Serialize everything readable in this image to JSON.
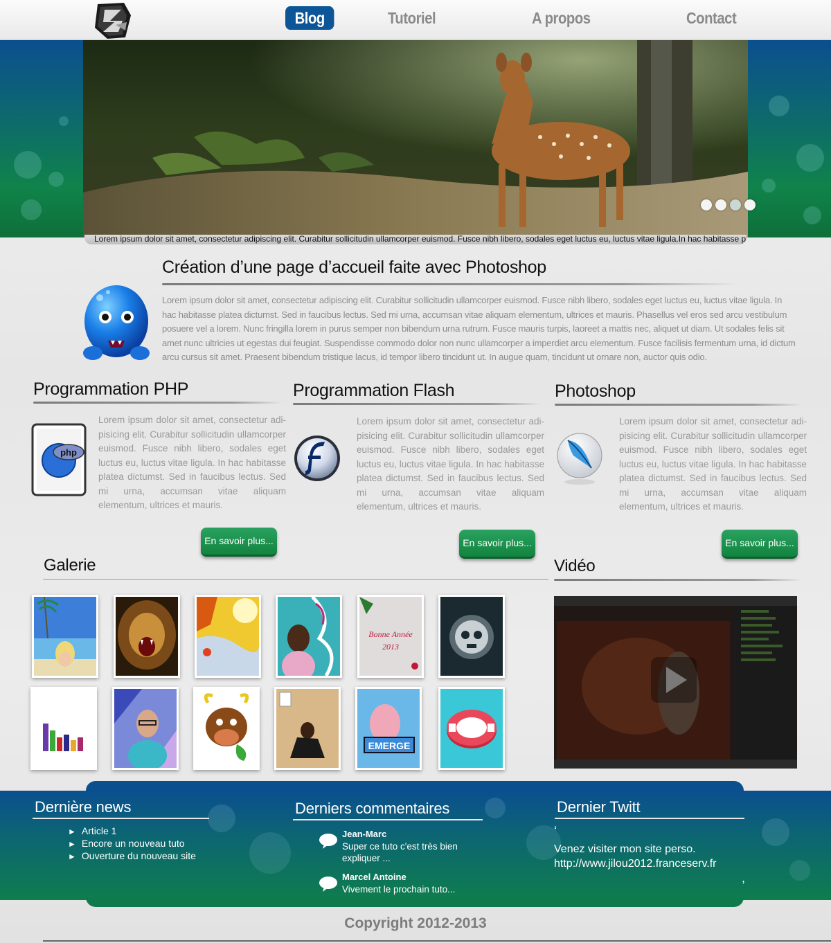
{
  "nav": {
    "items": [
      {
        "label": "Blog",
        "active": true
      },
      {
        "label": "Tutoriel"
      },
      {
        "label": "A propos"
      },
      {
        "label": "Contact"
      }
    ]
  },
  "banner": {
    "caption": "Lorem ipsum dolor sit amet, consectetur adipiscing elit. Curabitur sollicitudin ullamcorper euismod. Fusce nibh libero, sodales eget luctus eu, luctus vitae ligula.In hac habitasse platea dictumst.",
    "slide_count": 4,
    "active_slide": 1
  },
  "intro": {
    "title": "Création d’une page d’accueil faite avec Photoshop",
    "text": "Lorem ipsum dolor sit amet, consectetur adipiscing elit. Curabitur sollicitudin ullamcorper euismod. Fusce nibh libero, sodales eget luctus eu, luctus vitae ligula. In hac habitasse platea dictumst. Sed in faucibus lectus. Sed mi urna, accumsan vitae aliquam elementum, ultrices et mauris. Phasellus vel eros sed arcu vestibulum posuere vel a lorem. Nunc fringilla lorem in purus semper non bibendum urna rutrum. Fusce mauris turpis, laoreet a mattis nec, aliquet ut diam. Ut sodales felis sit amet nunc ultricies ut egestas dui feugiat. Suspendisse commodo dolor non nunc ullamcorper a imperdiet arcu elementum. Fusce facilisis fermentum urna, id dictum arcu cursus sit amet. Praesent bibendum tristique lacus, id tempor libero tincidunt ut. In augue quam, tincidunt ut ornare non, auctor quis odio."
  },
  "columns": [
    {
      "title": "Programmation PHP",
      "icon": "php-icon",
      "text": "Lorem ipsum dolor sit amet, consectetur adi-pisicing elit. Curabitur sollicitudin ullamcorper euismod. Fusce nibh libero, sodales eget luctus eu, luctus vitae ligula. In hac habitasse platea dictumst. Sed in faucibus lectus. Sed mi urna, accumsan vitae aliquam elementum, ultrices et mauris.",
      "button": "En savoir plus..."
    },
    {
      "title": "Programmation Flash",
      "icon": "flash-icon",
      "text": "Lorem ipsum dolor sit amet, consectetur adi-pisicing elit. Curabitur sollicitudin ullamcorper euismod. Fusce nibh libero, sodales eget luctus eu, luctus vitae ligula. In hac habitasse platea dictumst. Sed in faucibus lectus. Sed mi urna, accumsan vitae aliquam elementum, ultrices et mauris.",
      "button": "En savoir plus..."
    },
    {
      "title": "Photoshop",
      "icon": "feather-icon",
      "text": "Lorem ipsum dolor sit amet, consectetur adi-pisicing elit. Curabitur sollicitudin ullamcorper euismod. Fusce nibh libero, sodales eget luctus eu, luctus vitae ligula. In hac habitasse platea dictumst. Sed in faucibus lectus. Sed mi urna, accumsan vitae aliquam elementum, ultrices et mauris.",
      "button": "En savoir plus..."
    }
  ],
  "gallery": {
    "title": "Galerie",
    "thumb_count": 12,
    "greeting_card_text": [
      "Bonne Année",
      "2013"
    ],
    "emerge_text": "EMERGE"
  },
  "video": {
    "title": "Vidéo",
    "icon": "play-icon"
  },
  "footer": {
    "news": {
      "title": "Dernière news",
      "items": [
        "Article 1",
        "Encore un nouveau tuto",
        "Ouverture du nouveau site"
      ]
    },
    "comments": {
      "title": "Derniers commentaires",
      "items": [
        {
          "author": "Jean-Marc",
          "text": "Super ce tuto c'est très bien expliquer ..."
        },
        {
          "author": "Marcel Antoine",
          "text": "Vivement le prochain tuto..."
        }
      ]
    },
    "twitt": {
      "title": "Dernier Twitt",
      "open_quote": "‘",
      "close_quote": ",",
      "text": "Venez visiter mon site perso. http://www.jilou2012.franceserv.fr"
    }
  },
  "copyright": "Copyright 2012-2013",
  "colors": {
    "nav_active": "#0c5596",
    "button_green": "#12843f",
    "footer_blue": "#0b4f8f",
    "footer_green": "#0f7d4d"
  }
}
